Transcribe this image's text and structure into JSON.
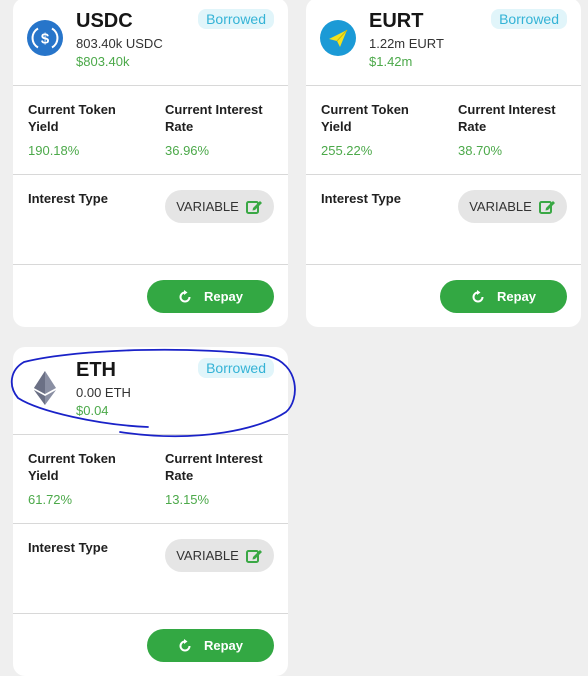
{
  "colors": {
    "background": "#efefef",
    "card": "#ffffff",
    "badge_bg": "#e1f5fa",
    "badge_text": "#34b3d6",
    "positive": "#4ca94a",
    "repay_button": "#33a843",
    "annotation_stroke": "#1a22c8"
  },
  "cards": [
    {
      "symbol": "USDC",
      "amount": "803.40k USDC",
      "usd_value": "$803.40k",
      "badge": "Borrowed",
      "token_yield_label": "Current Token Yield",
      "token_yield": "190.18%",
      "interest_rate_label": "Current Interest Rate",
      "interest_rate": "36.96%",
      "interest_type_label": "Interest Type",
      "interest_type": "VARIABLE",
      "repay_label": "Repay",
      "icon": "usdc-logo-icon"
    },
    {
      "symbol": "EURT",
      "amount": "1.22m EURT",
      "usd_value": "$1.42m",
      "badge": "Borrowed",
      "token_yield_label": "Current Token Yield",
      "token_yield": "255.22%",
      "interest_rate_label": "Current Interest Rate",
      "interest_rate": "38.70%",
      "interest_type_label": "Interest Type",
      "interest_type": "VARIABLE",
      "repay_label": "Repay",
      "icon": "eurt-logo-icon"
    },
    {
      "symbol": "ETH",
      "amount": "0.00 ETH",
      "usd_value": "$0.04",
      "badge": "Borrowed",
      "token_yield_label": "Current Token Yield",
      "token_yield": "61.72%",
      "interest_rate_label": "Current Interest Rate",
      "interest_rate": "13.15%",
      "interest_type_label": "Interest Type",
      "interest_type": "VARIABLE",
      "repay_label": "Repay",
      "icon": "eth-logo-icon"
    }
  ]
}
